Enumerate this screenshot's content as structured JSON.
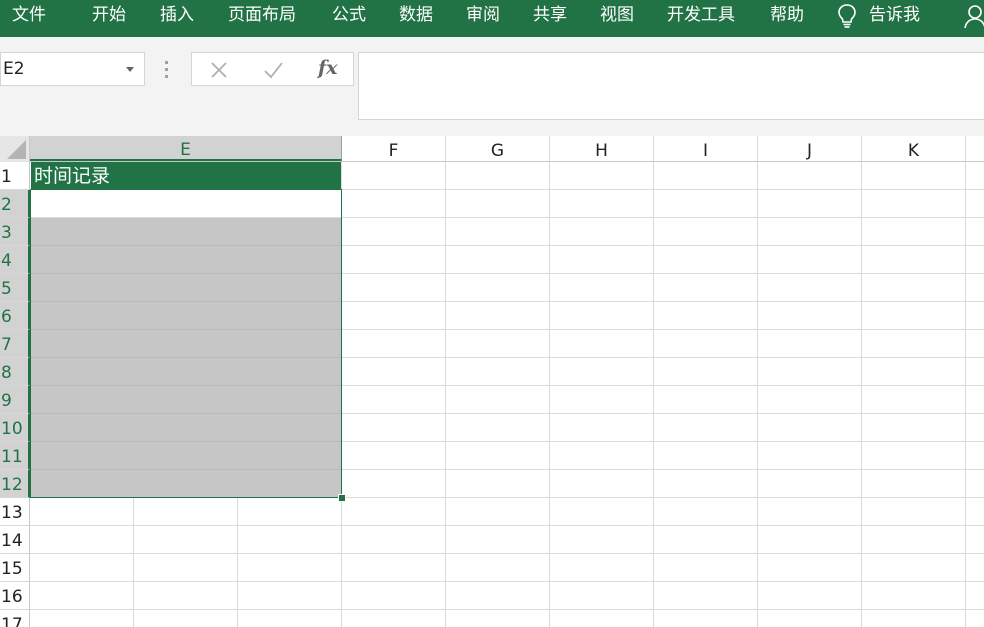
{
  "ribbon": {
    "tabs": [
      "文件",
      "开始",
      "插入",
      "页面布局",
      "公式",
      "数据",
      "审阅",
      "共享",
      "视图",
      "开发工具",
      "帮助"
    ],
    "tell_me": "告诉我"
  },
  "formula_bar": {
    "name_box": "E2",
    "fx": "fx",
    "value": ""
  },
  "sheet": {
    "columns": [
      "E",
      "F",
      "G",
      "H",
      "I",
      "J",
      "K"
    ],
    "rows": [
      "1",
      "2",
      "3",
      "4",
      "5",
      "6",
      "7",
      "8",
      "9",
      "10",
      "11",
      "12",
      "13",
      "14",
      "15",
      "16",
      "17"
    ],
    "header_cell_text": "时间记录",
    "selected_column": "E",
    "selected_rows": [
      "2",
      "3",
      "4",
      "5",
      "6",
      "7",
      "8",
      "9",
      "10",
      "11",
      "12"
    ]
  },
  "colors": {
    "accent": "#217346",
    "selection_fill": "#c6c6c6",
    "header_fill": "#217346"
  },
  "icons": {
    "bulb": "lightbulb-icon",
    "person": "person-share-icon",
    "cancel": "cancel-x-icon",
    "enter": "enter-check-icon",
    "dropdown": "chevron-down-icon"
  }
}
